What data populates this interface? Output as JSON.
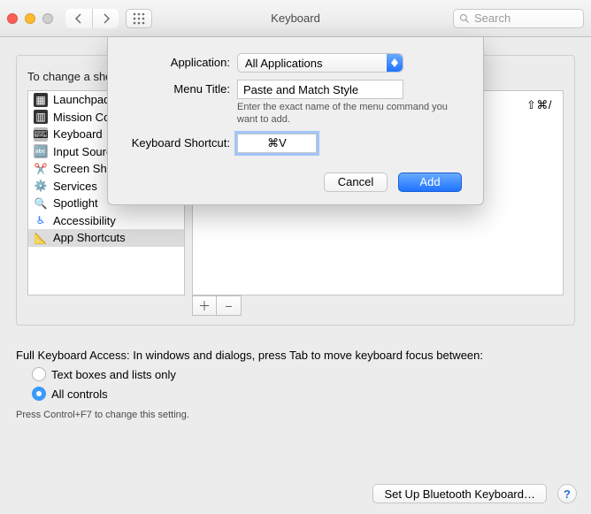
{
  "window": {
    "title": "Keyboard",
    "search_placeholder": "Search"
  },
  "intro_line": "To change a shortcut, select it, click the key combination, and then type the new keys.",
  "sidebar": {
    "items": [
      {
        "icon": "launchpad",
        "label": "Launchpad & Dock"
      },
      {
        "icon": "mission",
        "label": "Mission Control"
      },
      {
        "icon": "keyboard",
        "label": "Keyboard"
      },
      {
        "icon": "input",
        "label": "Input Sources"
      },
      {
        "icon": "screenshot",
        "label": "Screen Shots"
      },
      {
        "icon": "services",
        "label": "Services"
      },
      {
        "icon": "spotlight",
        "label": "Spotlight"
      },
      {
        "icon": "accessibility",
        "label": "Accessibility"
      },
      {
        "icon": "appshortcuts",
        "label": "App Shortcuts"
      }
    ],
    "selected_index": 8
  },
  "detail_panel": {
    "example_shortcut": "⇧⌘/"
  },
  "keyboard_access": {
    "intro": "Full Keyboard Access: In windows and dialogs, press Tab to move keyboard focus between:",
    "option_textboxes": "Text boxes and lists only",
    "option_all": "All controls",
    "selected": "all",
    "change_hint": "Press Control+F7 to change this setting."
  },
  "footer": {
    "bluetooth_btn": "Set Up Bluetooth Keyboard…",
    "help_label": "?"
  },
  "sheet": {
    "labels": {
      "application": "Application:",
      "menu_title": "Menu Title:",
      "keyboard_shortcut": "Keyboard Shortcut:",
      "hint": "Enter the exact name of the menu command you want to add."
    },
    "application_value": "All Applications",
    "menu_title_value": "Paste and Match Style",
    "shortcut_value": "⌘V",
    "buttons": {
      "cancel": "Cancel",
      "add": "Add"
    }
  }
}
